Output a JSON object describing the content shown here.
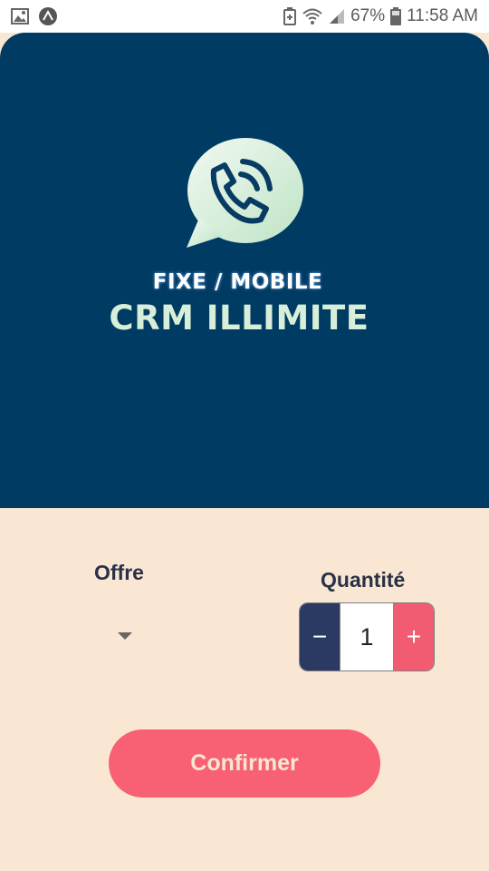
{
  "status_bar": {
    "battery_percent": "67%",
    "time": "11:58 AM",
    "icons": [
      "image-icon",
      "launcher-icon",
      "battery-saver-icon",
      "wifi-icon",
      "signal-icon",
      "battery-icon"
    ]
  },
  "hero": {
    "background_color": "#003b63",
    "logo_icon": "phone-chat-bubble-icon",
    "subtitle": "FIXE / MOBILE",
    "title": "CRM ILLIMITE"
  },
  "form": {
    "offer_label": "Offre",
    "offer_selected": "",
    "quantity_label": "Quantité",
    "quantity_value": "1",
    "minus_symbol": "−",
    "plus_symbol": "+",
    "confirm_label": "Confirmer"
  },
  "colors": {
    "page_background": "#f9e7d4",
    "accent": "#f86173",
    "stepper_minus": "#2b3a63",
    "stepper_plus": "#f25c72"
  }
}
